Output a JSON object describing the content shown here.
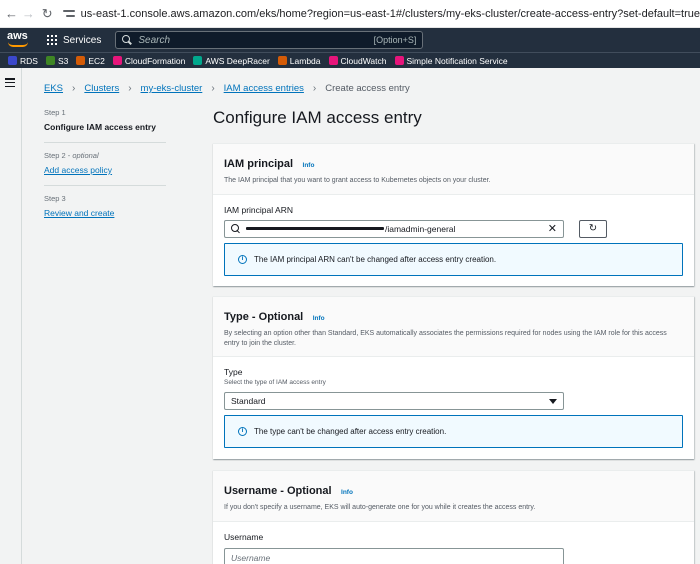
{
  "browser": {
    "url": "us-east-1.console.aws.amazon.com/eks/home?region=us-east-1#/clusters/my-eks-cluster/create-access-entry?set-default=true"
  },
  "topnav": {
    "logo": "aws",
    "services_label": "Services",
    "search_placeholder": "Search",
    "search_shortcut": "[Option+S]"
  },
  "favorites": [
    {
      "label": "RDS",
      "color": "#3b48cc"
    },
    {
      "label": "S3",
      "color": "#3f8624"
    },
    {
      "label": "EC2",
      "color": "#d45b07"
    },
    {
      "label": "CloudFormation",
      "color": "#e7157b"
    },
    {
      "label": "AWS DeepRacer",
      "color": "#01a88d"
    },
    {
      "label": "Lambda",
      "color": "#d45b07"
    },
    {
      "label": "CloudWatch",
      "color": "#e7157b"
    },
    {
      "label": "Simple Notification Service",
      "color": "#e7157b"
    }
  ],
  "breadcrumb": {
    "items": [
      "EKS",
      "Clusters",
      "my-eks-cluster",
      "IAM access entries"
    ],
    "current": "Create access entry"
  },
  "steps": [
    {
      "num": "Step 1",
      "optional": "",
      "title": "Configure IAM access entry"
    },
    {
      "num": "Step 2 - ",
      "optional": "optional",
      "title": "Add access policy"
    },
    {
      "num": "Step 3",
      "optional": "",
      "title": "Review and create"
    }
  ],
  "page_title": "Configure IAM access entry",
  "iam_principal": {
    "title": "IAM principal",
    "info": "Info",
    "description": "The IAM principal that you want to grant access to Kubernetes objects on your cluster.",
    "field_label": "IAM principal ARN",
    "arn_visible": "/iamadmin-general",
    "alert": "The IAM principal ARN can't be changed after access entry creation."
  },
  "type_section": {
    "title": "Type - Optional",
    "info": "Info",
    "description": "By selecting an option other than Standard, EKS automatically associates the permissions required for nodes using the IAM role for this access entry to join the cluster.",
    "field_label": "Type",
    "field_sub": "Select the type of IAM access entry",
    "selected": "Standard",
    "alert": "The type can't be changed after access entry creation."
  },
  "username_section": {
    "title": "Username - Optional",
    "info": "Info",
    "description": "If you don't specify a username, EKS will auto-generate one for you while it creates the access entry.",
    "field_label": "Username",
    "placeholder": "Username"
  },
  "colors": {
    "link": "#0073bb",
    "nav_bg": "#232f3e",
    "accent": "#ff9900",
    "page_bg": "#f2f3f3"
  }
}
